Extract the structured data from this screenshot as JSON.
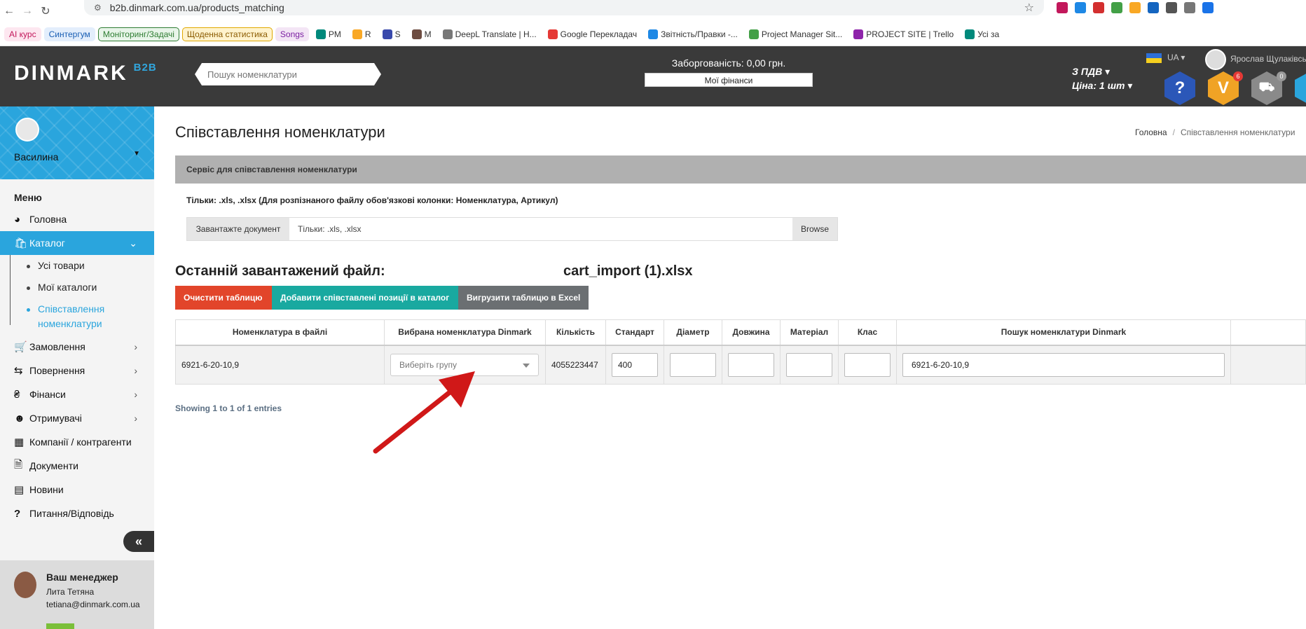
{
  "browser": {
    "url": "b2b.dinmark.com.ua/products_matching",
    "bookmarks": [
      {
        "label": "AI курс",
        "color": "#c2185b",
        "bg": "#fde7f0"
      },
      {
        "label": "Синтергум",
        "color": "#1a5fb4",
        "bg": "#e3eefc"
      },
      {
        "label": "Моніторинг/Задачі",
        "color": "#2e7d32",
        "bg": "#e8f5e9",
        "border": "#2e7d32"
      },
      {
        "label": "Щоденна статистика",
        "color": "#8a5a00",
        "bg": "#fff3cd",
        "border": "#e0a800"
      },
      {
        "label": "Songs",
        "color": "#7b1fa2",
        "bg": "#f3e5f5"
      },
      {
        "label": "PM"
      },
      {
        "label": "R"
      },
      {
        "label": "S"
      },
      {
        "label": "M"
      },
      {
        "label": "DeepL Translate | H..."
      },
      {
        "label": "Google Перекладач"
      },
      {
        "label": "Звітність/Правки -..."
      },
      {
        "label": "Project Manager Sit..."
      },
      {
        "label": "PROJECT SITE | Trello"
      },
      {
        "label": "Усі за"
      }
    ]
  },
  "header": {
    "logo": "DINMARK",
    "logo_suffix": "B2B",
    "search_placeholder": "Пошук номенклатури",
    "debt": "Заборгованість: 0,00 грн.",
    "finance_button": "Мої фінанси",
    "vat": "З ПДВ",
    "price": "Ціна: 1 шт",
    "lang": "UA",
    "user_name": "Ярослав Щулаківсь",
    "cart_badge": "6",
    "delivery_badge": "0",
    "help_glyph": "?",
    "cart_glyph": "V"
  },
  "sidebar": {
    "profile_name": "Василина",
    "menu_title": "Меню",
    "items": [
      {
        "label": "Головна",
        "icon": "dashboard-icon"
      },
      {
        "label": "Каталог",
        "icon": "bag-icon",
        "active": true
      },
      {
        "label": "Замовлення",
        "icon": "cart-icon"
      },
      {
        "label": "Повернення",
        "icon": "exchange-icon"
      },
      {
        "label": "Фінанси",
        "icon": "hryvnia-icon"
      },
      {
        "label": "Отримувачі",
        "icon": "users-icon"
      },
      {
        "label": "Компанії / контрагенти",
        "icon": "building-icon"
      },
      {
        "label": "Документи",
        "icon": "document-icon"
      },
      {
        "label": "Новини",
        "icon": "newspaper-icon"
      },
      {
        "label": "Питання/Відповідь",
        "icon": "question-icon"
      }
    ],
    "catalog_sub": [
      "Усі товари",
      "Мої каталоги",
      "Співставлення номенклатури"
    ],
    "manager": {
      "title": "Ваш менеджер",
      "name": "Лита Тетяна",
      "email": "tetiana@dinmark.com.ua"
    }
  },
  "main": {
    "title": "Співставлення номенклатури",
    "breadcrumb": {
      "home": "Головна",
      "current": "Співставлення номенклатури"
    },
    "service_bar": "Сервіс для співставлення номенклатури",
    "hint": "Тільки: .xls, .xlsx (Для розпізнаного файлу обов'язкові колонки: Номенклатура, Артикул)",
    "upload": {
      "label": "Завантажте документ",
      "placeholder": "Тільки: .xls, .xlsx",
      "browse": "Browse"
    },
    "last_file_label": "Останній завантажений файл:",
    "last_file_name": "cart_import (1).xlsx",
    "buttons": {
      "clear": "Очистити таблицю",
      "add": "Добавити співставлені позиції в каталог",
      "export": "Вигрузити таблицю в Excel"
    },
    "table": {
      "columns": [
        "Номенклатура в файлі",
        "Вибрана номенклатура Dinmark",
        "Кількість",
        "Стандарт",
        "Діаметр",
        "Довжина",
        "Матеріал",
        "Клас",
        "Пошук номенклатури Dinmark"
      ],
      "rows": [
        {
          "file_name": "6921-6-20-10,9",
          "select_placeholder": "Виберіть групу",
          "quantity": "4055223447",
          "standard": "400",
          "diameter": "",
          "length": "",
          "material": "",
          "class": "",
          "search": "6921-6-20-10,9"
        }
      ]
    },
    "entries": "Showing 1 to 1 of 1 entries"
  },
  "colors": {
    "accent": "#2aa5dd",
    "header_bg": "#3a3a3a",
    "btn_clear": "#e2452a",
    "btn_add": "#19a9a0",
    "btn_export": "#6b6f72",
    "arrow": "#d01818"
  }
}
